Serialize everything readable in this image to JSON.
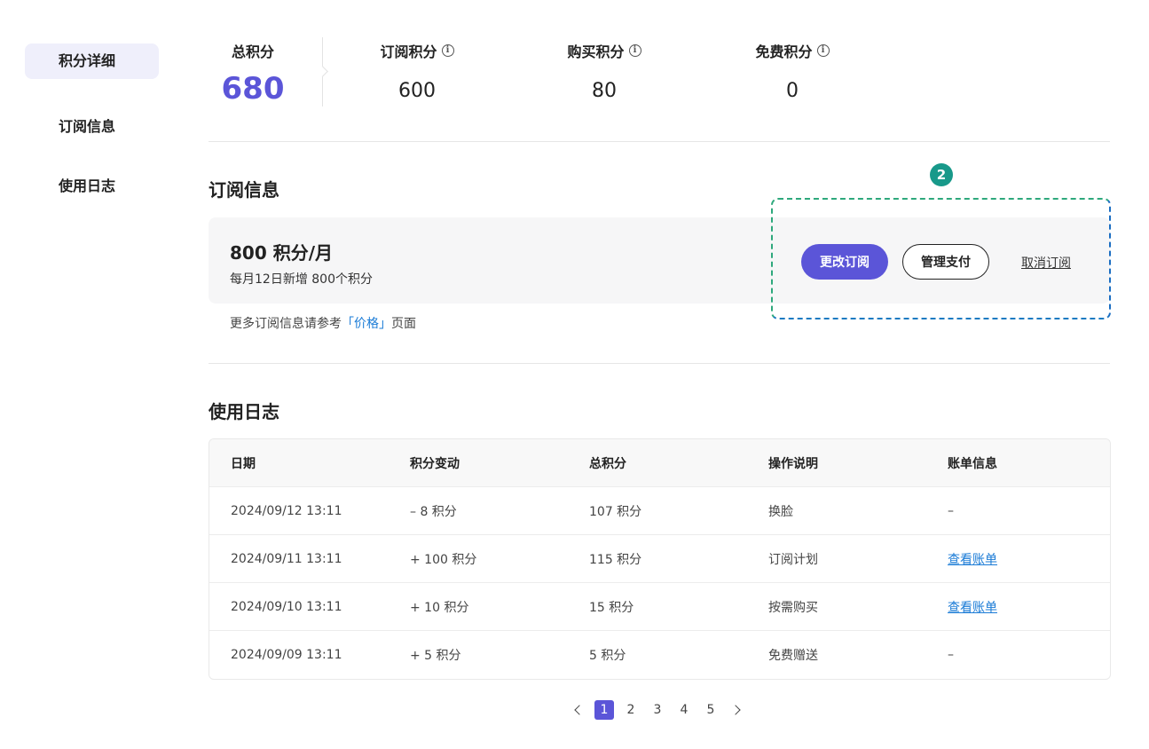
{
  "sidebar": {
    "items": [
      {
        "label": "积分详细",
        "active": true
      },
      {
        "label": "订阅信息",
        "active": false
      },
      {
        "label": "使用日志",
        "active": false
      }
    ]
  },
  "summary": {
    "total_label": "总积分",
    "total_value": "680",
    "subscription_label": "订阅积分",
    "subscription_value": "600",
    "purchase_label": "购买积分",
    "purchase_value": "80",
    "free_label": "免费积分",
    "free_value": "0"
  },
  "subscription": {
    "title": "订阅信息",
    "plan_name": "800 积分/月",
    "plan_desc": "每月12日新增 800个积分",
    "change_button": "更改订阅",
    "manage_button": "管理支付",
    "cancel_link": "取消订阅",
    "highlight_badge": "2",
    "more_info_prefix": "更多订阅信息请参考",
    "more_info_link": "「价格」",
    "more_info_suffix": "页面"
  },
  "log": {
    "title": "使用日志",
    "columns": [
      "日期",
      "积分变动",
      "总积分",
      "操作说明",
      "账单信息"
    ],
    "rows": [
      {
        "date": "2024/09/12 13:11",
        "change": "– 8 积分",
        "total": "107 积分",
        "desc": "换脸",
        "bill": "–"
      },
      {
        "date": "2024/09/11 13:11",
        "change": "+ 100 积分",
        "total": "115 积分",
        "desc": "订阅计划",
        "bill": "查看账单"
      },
      {
        "date": "2024/09/10 13:11",
        "change": "+ 10 积分",
        "total": "15 积分",
        "desc": "按需购买",
        "bill": "查看账单"
      },
      {
        "date": "2024/09/09 13:11",
        "change": "+ 5 积分",
        "total": "5 积分",
        "desc": "免费赠送",
        "bill": "–"
      }
    ]
  },
  "pagination": {
    "pages": [
      "1",
      "2",
      "3",
      "4",
      "5"
    ],
    "current": "1"
  },
  "colors": {
    "accent": "#5b55d8",
    "link": "#1a7bd6",
    "badge": "#18998a"
  }
}
